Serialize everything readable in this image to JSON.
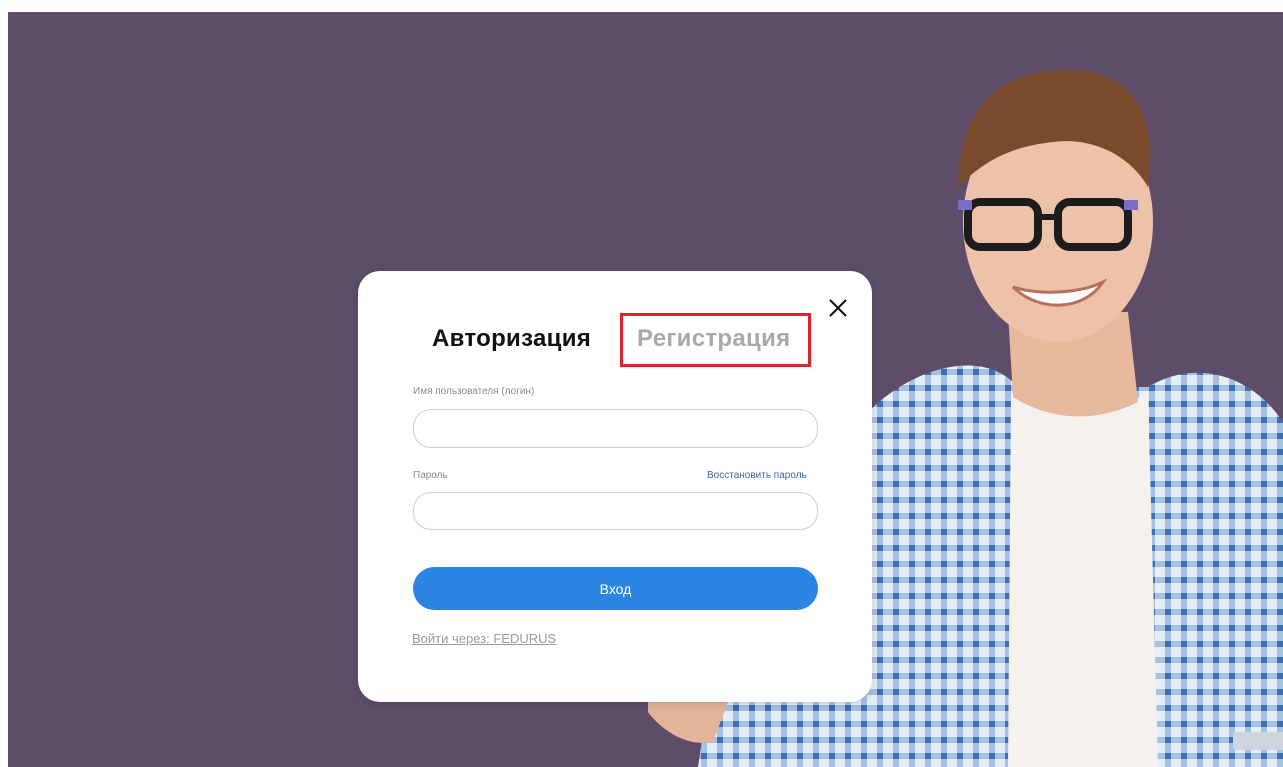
{
  "modal": {
    "tabs": {
      "login": "Авторизация",
      "register": "Регистрация"
    },
    "username": {
      "label": "Имя пользователя (логин)",
      "value": ""
    },
    "password": {
      "label": "Пароль",
      "recover": "Восстановить пароль",
      "value": ""
    },
    "submit": "Вход",
    "alt_login": "Войти через: FEDURUS",
    "close_icon": "close-icon"
  },
  "colors": {
    "background": "#5e4d69",
    "primary_button": "#2b86e3",
    "highlight_box": "#d9232e",
    "inactive_tab": "#a9a9a9"
  }
}
